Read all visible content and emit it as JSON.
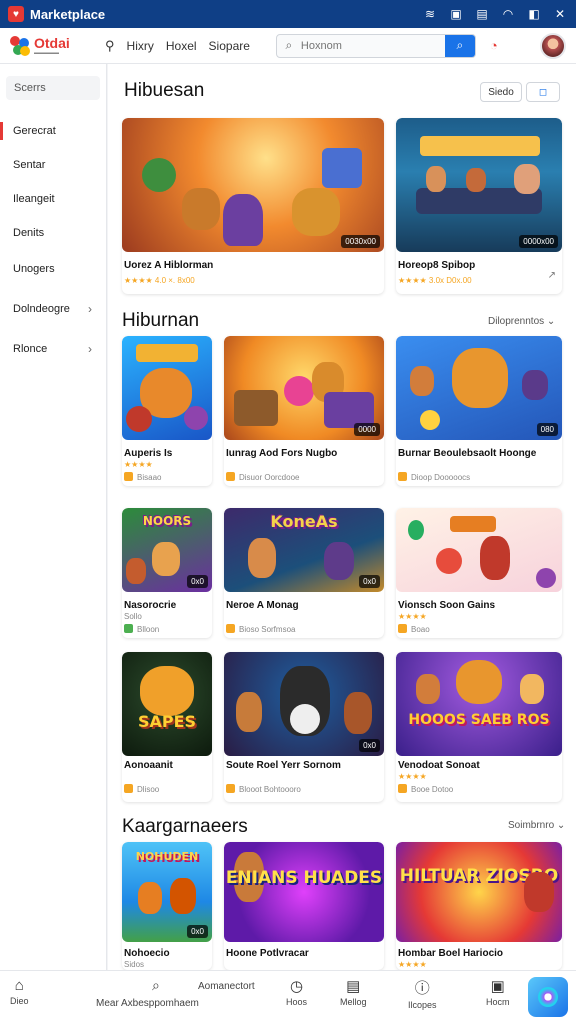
{
  "titlebar": {
    "app_name": "Marketplace",
    "icons": [
      "wifi-icon",
      "photo-icon",
      "save-icon",
      "wifi-icon",
      "info-icon",
      "close-icon"
    ]
  },
  "header": {
    "logo_text": "Otdai",
    "nav": [
      "Hixry",
      "Hoxel",
      "Siopare"
    ],
    "search_placeholder": "Hoxnom",
    "icons": [
      "user-icon",
      "search-icon",
      "cart-icon",
      "avatar"
    ]
  },
  "sidebar": {
    "search_label": "Scerrs",
    "items": [
      {
        "label": "Gerecrat"
      },
      {
        "label": "Sentar"
      },
      {
        "label": "Ileangeit"
      },
      {
        "label": "Denits"
      },
      {
        "label": "Unogers"
      },
      {
        "label": "Dolndeogre"
      },
      {
        "label": "Rlonce"
      }
    ]
  },
  "sections": [
    {
      "title": "Hibuesan",
      "buttons": [
        "Siedo",
        "◻"
      ]
    },
    {
      "title": "Hiburnan",
      "link": "Diloprenntos"
    },
    {
      "title": "Kaargarnaeers",
      "link": "Soimbrnro"
    }
  ],
  "featured": [
    {
      "name": "Uorez A Hiblorman",
      "meta": "★★★★ 4.0  ×. 8x00",
      "badge": "0030x00"
    },
    {
      "name": "Horeop8 Spibop",
      "meta": "★★★★ 3.0x  D0x.00",
      "badge": "0000x00"
    }
  ],
  "grid": [
    {
      "name": "Auperis Is",
      "meta1": "★★★★",
      "meta2": "Bisaao",
      "badge": ""
    },
    {
      "name": "Iunrag Aod Fors Nugbo",
      "meta1": "",
      "meta2": "Disuor  Oorcdooe",
      "badge": "0000"
    },
    {
      "name": "Burnar Beoulebsaolt Hoonge",
      "meta1": "",
      "meta2": "Dioop  Dooooocs",
      "badge": "080"
    },
    {
      "name": "Nasorocrie",
      "meta1": "Sollo",
      "meta2": "Blloon",
      "badge": "0x0"
    },
    {
      "name": "Neroe A Monag",
      "meta1": "",
      "meta2": "Bioso  Sorfmsoa",
      "badge": "0x0"
    },
    {
      "name": "Vionsch Soon Gains",
      "meta1": "★★★★",
      "meta2": "Boao",
      "badge": ""
    },
    {
      "name": "Aonoaanit",
      "meta1": "",
      "meta2": "Dlisoo",
      "badge": ""
    },
    {
      "name": "Soute Roel Yerr Sornom",
      "meta1": "",
      "meta2": "Blooot  Bohtoooro",
      "badge": "0x0"
    },
    {
      "name": "Venodoat Sonoat",
      "meta1": "★★★★",
      "meta2": "Booe  Dotoo",
      "badge": ""
    }
  ],
  "grid_logos": [
    "",
    "",
    "",
    "NOORS",
    "KoneAs",
    "",
    "SAPES",
    "",
    "HOOOS SAEB ROS"
  ],
  "bottom_row": [
    {
      "name": "Nohoecio",
      "meta": "Sidos",
      "logo": "NOHUDEN"
    },
    {
      "name": "Hoone Potlvracar",
      "meta": "",
      "logo": "ENIANS HUADES"
    },
    {
      "name": "Hombar Boel Hariocio",
      "meta": "★★★★",
      "logo": "HILTUAR ZIOSRO"
    }
  ],
  "bottom_nav": [
    {
      "label": "Dieo",
      "icon": "home-icon"
    },
    {
      "label": "Hoos",
      "icon": "clock-icon"
    },
    {
      "label": "Mellog",
      "icon": "book-icon"
    },
    {
      "label": "Ilcopes",
      "icon": "info-icon"
    },
    {
      "label": "Hocm",
      "icon": "notification-icon"
    }
  ],
  "bottom_search": {
    "title": "Aomanectort",
    "sub": "Mear Axbesppomhaem"
  },
  "colors": {
    "accent": "#e53935",
    "primary": "#1a73e8",
    "titlebar": "#0f3f86",
    "star": "#f5a623"
  }
}
